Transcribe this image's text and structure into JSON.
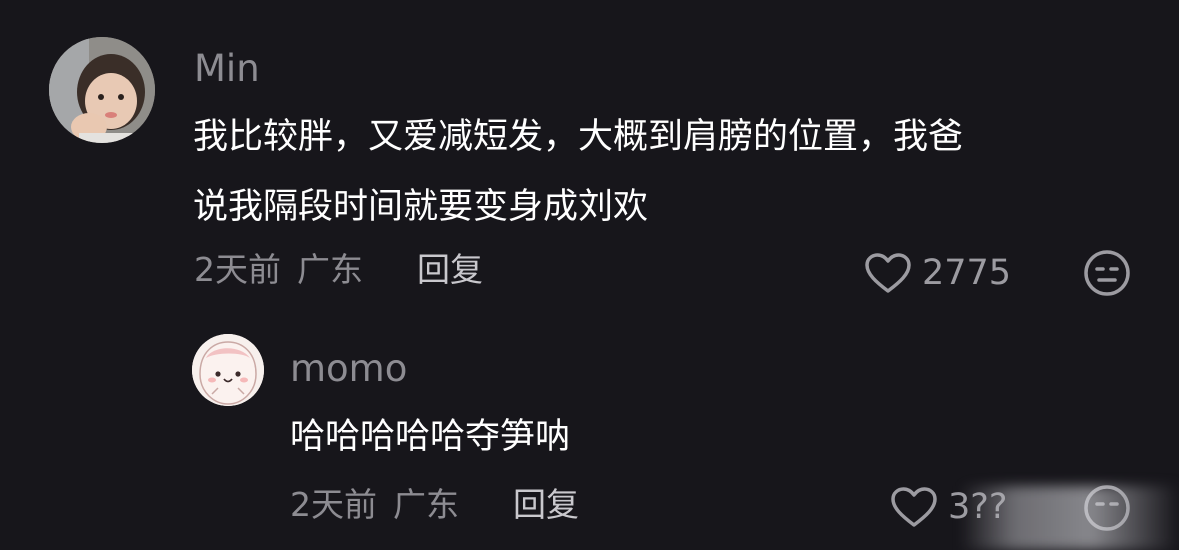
{
  "comments": [
    {
      "username": "Min",
      "text": "我比较胖，又爱减短发，大概到肩膀的位置，我爸说我隔段时间就要变身成刘欢",
      "text_lines": [
        "我比较胖，又爱减短发，大概到肩膀的位置，我爸",
        "说我隔段时间就要变身成刘欢"
      ],
      "time": "2天前",
      "location": "广东",
      "reply_label": "回复",
      "like_count": "2775",
      "avatar_icon": "child-photo-avatar",
      "action_icon": "dislike-face-icon"
    },
    {
      "username": "momo",
      "text": "哈哈哈哈哈夺笋呐",
      "time": "2天前",
      "location": "广东",
      "reply_label": "回复",
      "like_count": "3??",
      "avatar_icon": "cartoon-avatar",
      "action_icon": "dislike-face-icon"
    }
  ],
  "colors": {
    "background": "#17161b",
    "muted_text": "#8d8c92",
    "primary_text": "#ffffff"
  }
}
